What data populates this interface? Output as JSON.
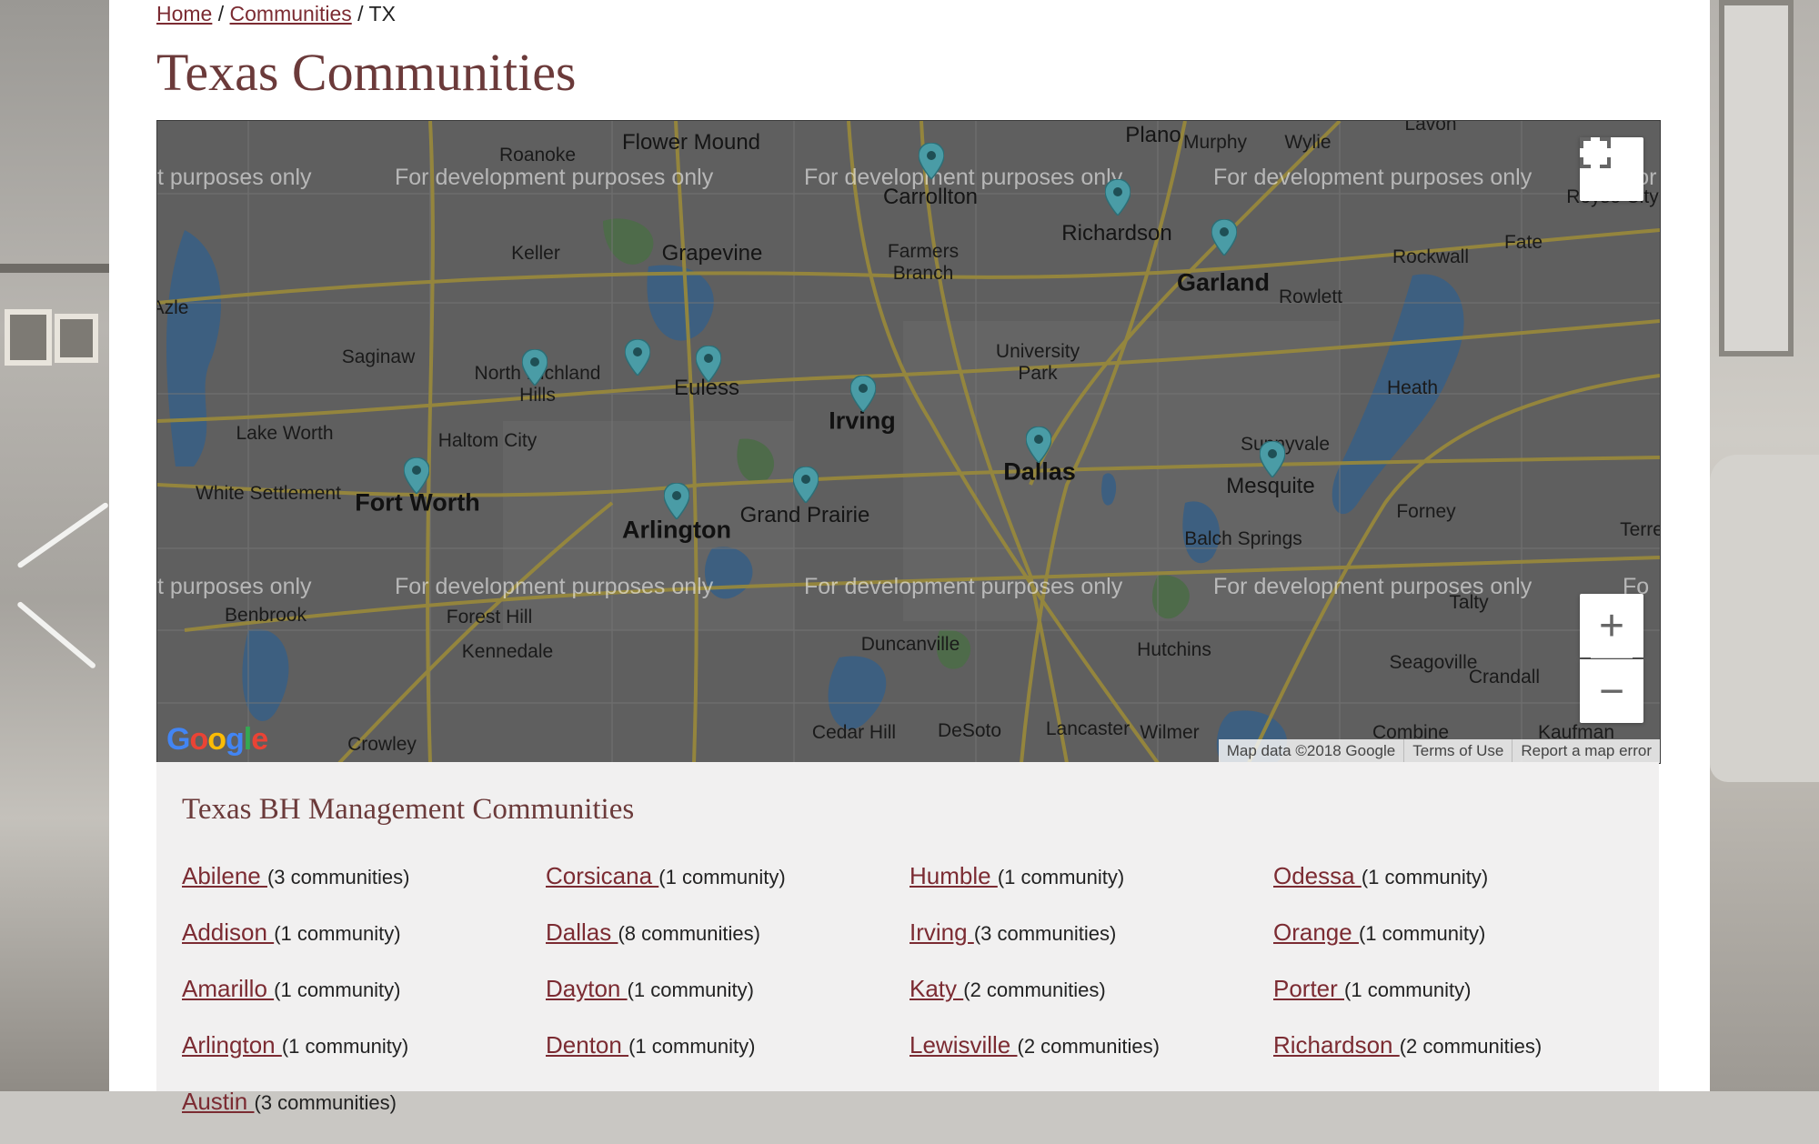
{
  "breadcrumb": {
    "home": "Home",
    "communities": "Communities",
    "separator": "/",
    "current": "TX"
  },
  "page_title": "Texas Communities",
  "map": {
    "watermark": "For development purposes only",
    "watermark_partial_left": "t purposes only",
    "watermark_partial_right_1": "For",
    "watermark_partial_right_2": "Fo",
    "google_logo": "Google",
    "attribution": {
      "map_data": "Map data ©2018 Google",
      "terms": "Terms of Use",
      "report": "Report a map error"
    },
    "zoom_in_label": "+",
    "zoom_out_label": "−",
    "labels": [
      {
        "key": "plano",
        "text": "Plano"
      },
      {
        "key": "flower_mound",
        "text": "Flower Mound"
      },
      {
        "key": "roanoke",
        "text": "Roanoke"
      },
      {
        "key": "murphy",
        "text": "Murphy"
      },
      {
        "key": "wylie",
        "text": "Wylie"
      },
      {
        "key": "lavon",
        "text": "Lavon"
      },
      {
        "key": "carrollton",
        "text": "Carrollton"
      },
      {
        "key": "richardson",
        "text": "Richardson"
      },
      {
        "key": "royse",
        "text": "Royse City"
      },
      {
        "key": "keller",
        "text": "Keller"
      },
      {
        "key": "grapevine",
        "text": "Grapevine"
      },
      {
        "key": "farmers_branch",
        "text": "Farmers Branch"
      },
      {
        "key": "garland",
        "text": "Garland"
      },
      {
        "key": "rockwall",
        "text": "Rockwall"
      },
      {
        "key": "fate",
        "text": "Fate"
      },
      {
        "key": "rowlett",
        "text": "Rowlett"
      },
      {
        "key": "azle",
        "text": "Azle"
      },
      {
        "key": "saginaw",
        "text": "Saginaw"
      },
      {
        "key": "north_richland_hills",
        "text": "North Richland Hills"
      },
      {
        "key": "euless",
        "text": "Euless"
      },
      {
        "key": "university_park",
        "text": "University Park"
      },
      {
        "key": "heath",
        "text": "Heath"
      },
      {
        "key": "irving",
        "text": "Irving"
      },
      {
        "key": "lake_worth",
        "text": "Lake Worth"
      },
      {
        "key": "haltom_city",
        "text": "Haltom City"
      },
      {
        "key": "sunnyvale",
        "text": "Sunnyvale"
      },
      {
        "key": "white_settlement",
        "text": "White Settlement"
      },
      {
        "key": "dallas",
        "text": "Dallas"
      },
      {
        "key": "mesquite",
        "text": "Mesquite"
      },
      {
        "key": "fort_worth",
        "text": "Fort Worth"
      },
      {
        "key": "grand_prairie",
        "text": "Grand Prairie"
      },
      {
        "key": "arlington",
        "text": "Arlington"
      },
      {
        "key": "forney",
        "text": "Forney"
      },
      {
        "key": "balch_springs",
        "text": "Balch Springs"
      },
      {
        "key": "terrell",
        "text": "Terre"
      },
      {
        "key": "benbrook",
        "text": "Benbrook"
      },
      {
        "key": "forest_hill",
        "text": "Forest Hill"
      },
      {
        "key": "talty",
        "text": "Talty"
      },
      {
        "key": "kennedale",
        "text": "Kennedale"
      },
      {
        "key": "duncanville",
        "text": "Duncanville"
      },
      {
        "key": "hutchins",
        "text": "Hutchins"
      },
      {
        "key": "seagoville",
        "text": "Seagoville"
      },
      {
        "key": "crandall",
        "text": "Crandall"
      },
      {
        "key": "crowley",
        "text": "Crowley"
      },
      {
        "key": "cedar_hill",
        "text": "Cedar Hill"
      },
      {
        "key": "desoto",
        "text": "DeSoto"
      },
      {
        "key": "lancaster",
        "text": "Lancaster"
      },
      {
        "key": "wilmer",
        "text": "Wilmer"
      },
      {
        "key": "combine",
        "text": "Combine"
      },
      {
        "key": "kaufman",
        "text": "Kaufman"
      }
    ]
  },
  "section_title": "Texas BH Management Communities",
  "columns": [
    [
      {
        "city": "Abilene ",
        "count": "(3 communities)"
      },
      {
        "city": "Addison ",
        "count": "(1 community)"
      },
      {
        "city": "Amarillo ",
        "count": "(1 community)"
      },
      {
        "city": "Arlington ",
        "count": "(1 community)"
      },
      {
        "city": "Austin ",
        "count": "(3 communities)"
      }
    ],
    [
      {
        "city": "Corsicana ",
        "count": "(1 community)"
      },
      {
        "city": "Dallas ",
        "count": "(8 communities)"
      },
      {
        "city": "Dayton ",
        "count": "(1 community)"
      },
      {
        "city": "Denton ",
        "count": "(1 community)"
      }
    ],
    [
      {
        "city": "Humble ",
        "count": "(1 community)"
      },
      {
        "city": "Irving ",
        "count": "(3 communities)"
      },
      {
        "city": "Katy ",
        "count": "(2 communities)"
      },
      {
        "city": "Lewisville ",
        "count": "(2 communities)"
      }
    ],
    [
      {
        "city": "Odessa ",
        "count": "(1 community)"
      },
      {
        "city": "Orange ",
        "count": "(1 community)"
      },
      {
        "city": "Porter ",
        "count": "(1 community)"
      },
      {
        "city": "Richardson ",
        "count": "(2 communities)"
      }
    ]
  ],
  "colors": {
    "link": "#7b2b32",
    "heading": "#6b3a3a",
    "pin": "#4a9ca6",
    "map_overlay": "#5c5c5c"
  }
}
